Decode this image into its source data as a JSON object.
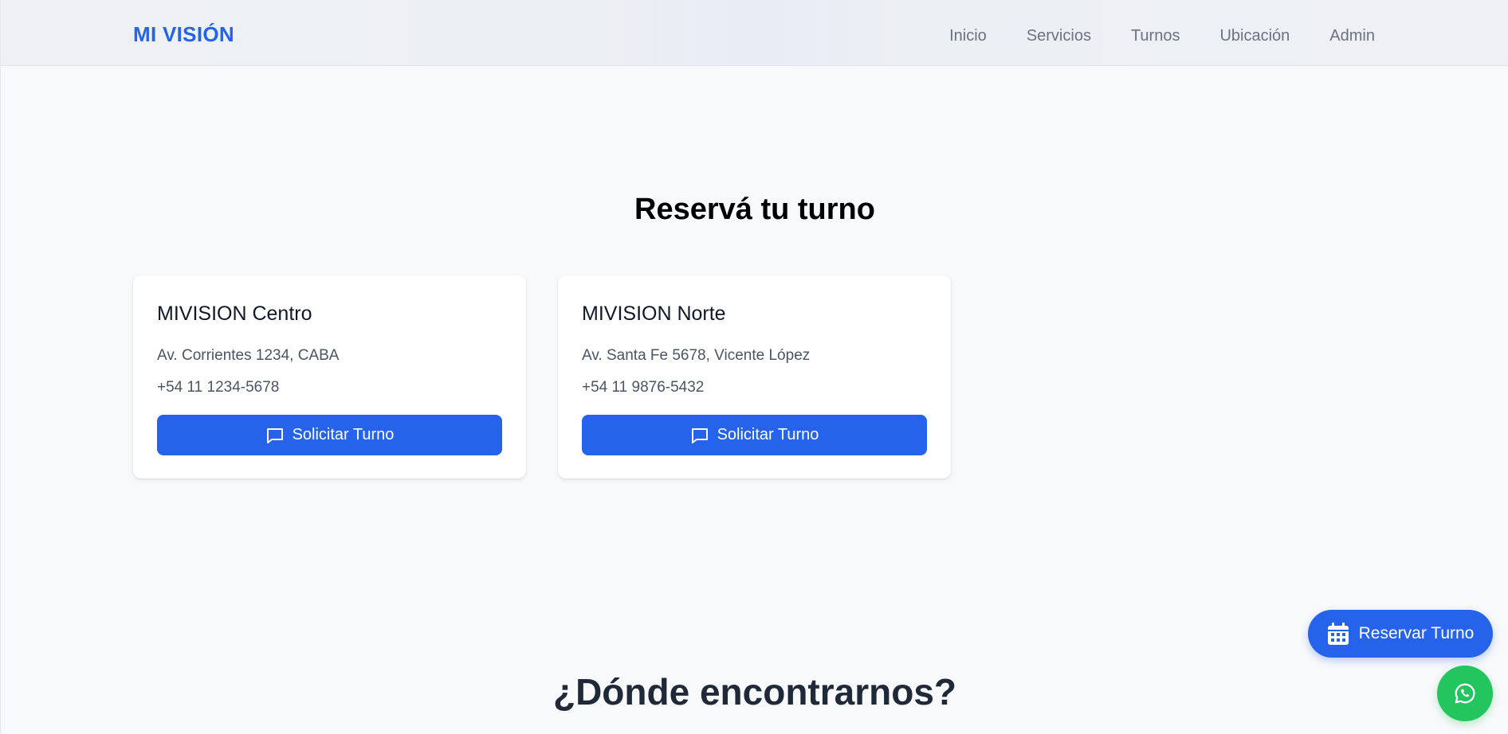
{
  "header": {
    "brand": "MI VISIÓN",
    "nav": [
      "Inicio",
      "Servicios",
      "Turnos",
      "Ubicación",
      "Admin"
    ]
  },
  "booking": {
    "title": "Reservá tu turno",
    "branches": [
      {
        "name": "MIVISION Centro",
        "address": "Av. Corrientes 1234, CABA",
        "phone": "+54 11 1234-5678",
        "button_label": "Solicitar Turno",
        "button_icon": "chat-icon"
      },
      {
        "name": "MIVISION Norte",
        "address": "Av. Santa Fe 5678, Vicente López",
        "phone": "+54 11 9876-5432",
        "button_label": "Solicitar Turno",
        "button_icon": "chat-icon"
      }
    ]
  },
  "location": {
    "title": "¿Dónde encontrarnos?"
  },
  "floating": {
    "reserve_label": "Reservar Turno",
    "reserve_icon": "calendar-icon",
    "whatsapp_icon": "whatsapp-icon"
  },
  "colors": {
    "accent": "#2563eb",
    "whatsapp": "#22c55e",
    "background": "#f8f9fb"
  }
}
